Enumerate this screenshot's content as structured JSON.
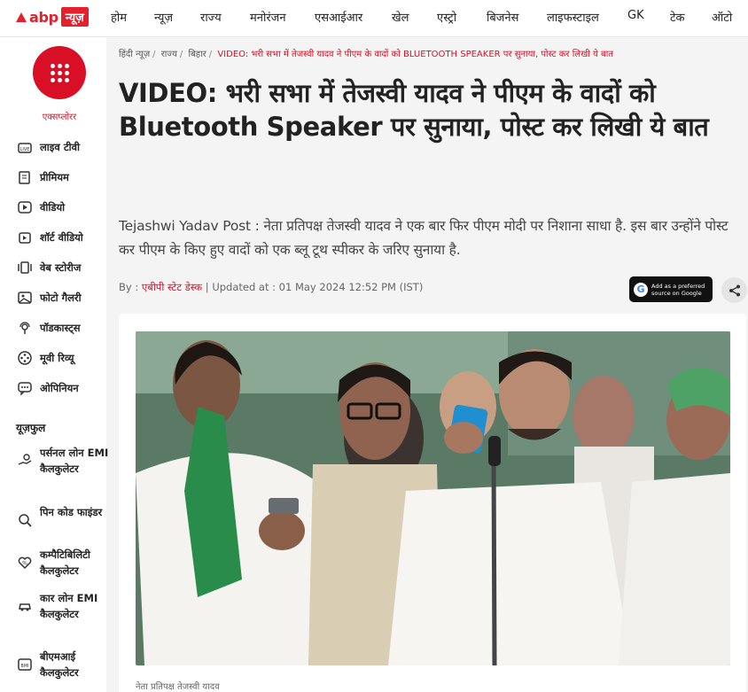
{
  "brand": {
    "name": "abp",
    "badge": "न्यूज़"
  },
  "nav": [
    "होम",
    "न्यूज़",
    "राज्य",
    "मनोरंजन",
    "एसआईआर",
    "खेल",
    "एस्ट्रो",
    "बिजनेस",
    "लाइफस्टाइल",
    "GK",
    "टेक",
    "ऑटो"
  ],
  "sidebar": {
    "explore_label": "एक्सप्लोरर",
    "items": [
      {
        "label": "लाइव टीवी",
        "icon": "live-tv-icon"
      },
      {
        "label": "प्रीमियम",
        "icon": "premium-icon"
      },
      {
        "label": "वीडियो",
        "icon": "video-icon"
      },
      {
        "label": "शॉर्ट वीडियो",
        "icon": "short-video-icon"
      },
      {
        "label": "वेब स्टोरीज",
        "icon": "web-stories-icon"
      },
      {
        "label": "फोटो गैलरी",
        "icon": "photo-gallery-icon"
      },
      {
        "label": "पॉडकास्ट्स",
        "icon": "podcast-icon"
      },
      {
        "label": "मूवी रिव्यू",
        "icon": "movie-review-icon"
      },
      {
        "label": "ओपिनियन",
        "icon": "opinion-icon"
      }
    ],
    "useful_heading": "यूज़फुल",
    "utilities": [
      {
        "label": "पर्सनल लोन EMI कैलकुलेटर",
        "icon": "personal-loan-icon"
      },
      {
        "label": "पिन कोड फाइंडर",
        "icon": "pincode-finder-icon"
      },
      {
        "label": "कम्पैटिबिलिटी कैलकुलेटर",
        "icon": "compatibility-icon"
      },
      {
        "label": "कार लोन EMI कैलकुलेटर",
        "icon": "car-loan-icon"
      },
      {
        "label": "बीएमआई कैलकुलेटर",
        "icon": "bmi-icon"
      }
    ]
  },
  "breadcrumb": {
    "items": [
      "हिंदी न्यूज़",
      "राज्य",
      "बिहार"
    ],
    "current": "VIDEO: भरी सभा में तेजस्वी यादव ने पीएम के वादों को BLUETOOTH SPEAKER पर सुनाया, पोस्ट कर लिखी ये बात"
  },
  "article": {
    "title": "VIDEO: भरी सभा में तेजस्वी यादव ने पीएम के वादों को Bluetooth Speaker पर सुनाया, पोस्ट कर लिखी ये बात",
    "summary": "Tejashwi Yadav Post : नेता प्रतिपक्ष तेजस्वी यादव ने एक बार फिर पीएम मोदी पर निशाना साधा है. इस बार उन्होंने पोस्ट कर पीएम के किए हुए वादों को एक ब्लू टूथ स्पीकर के जरिए सुनाया है.",
    "by_prefix": "By :",
    "author": "एबीपी स्टेट डेस्क",
    "updated": "| Updated at : 01 May 2024 12:52 PM (IST)",
    "google_badge": "Add as a preferred source on Google",
    "caption": "नेता प्रतिपक्ष तेजस्वी यादव"
  },
  "colors": {
    "accent": "#d90f26"
  }
}
